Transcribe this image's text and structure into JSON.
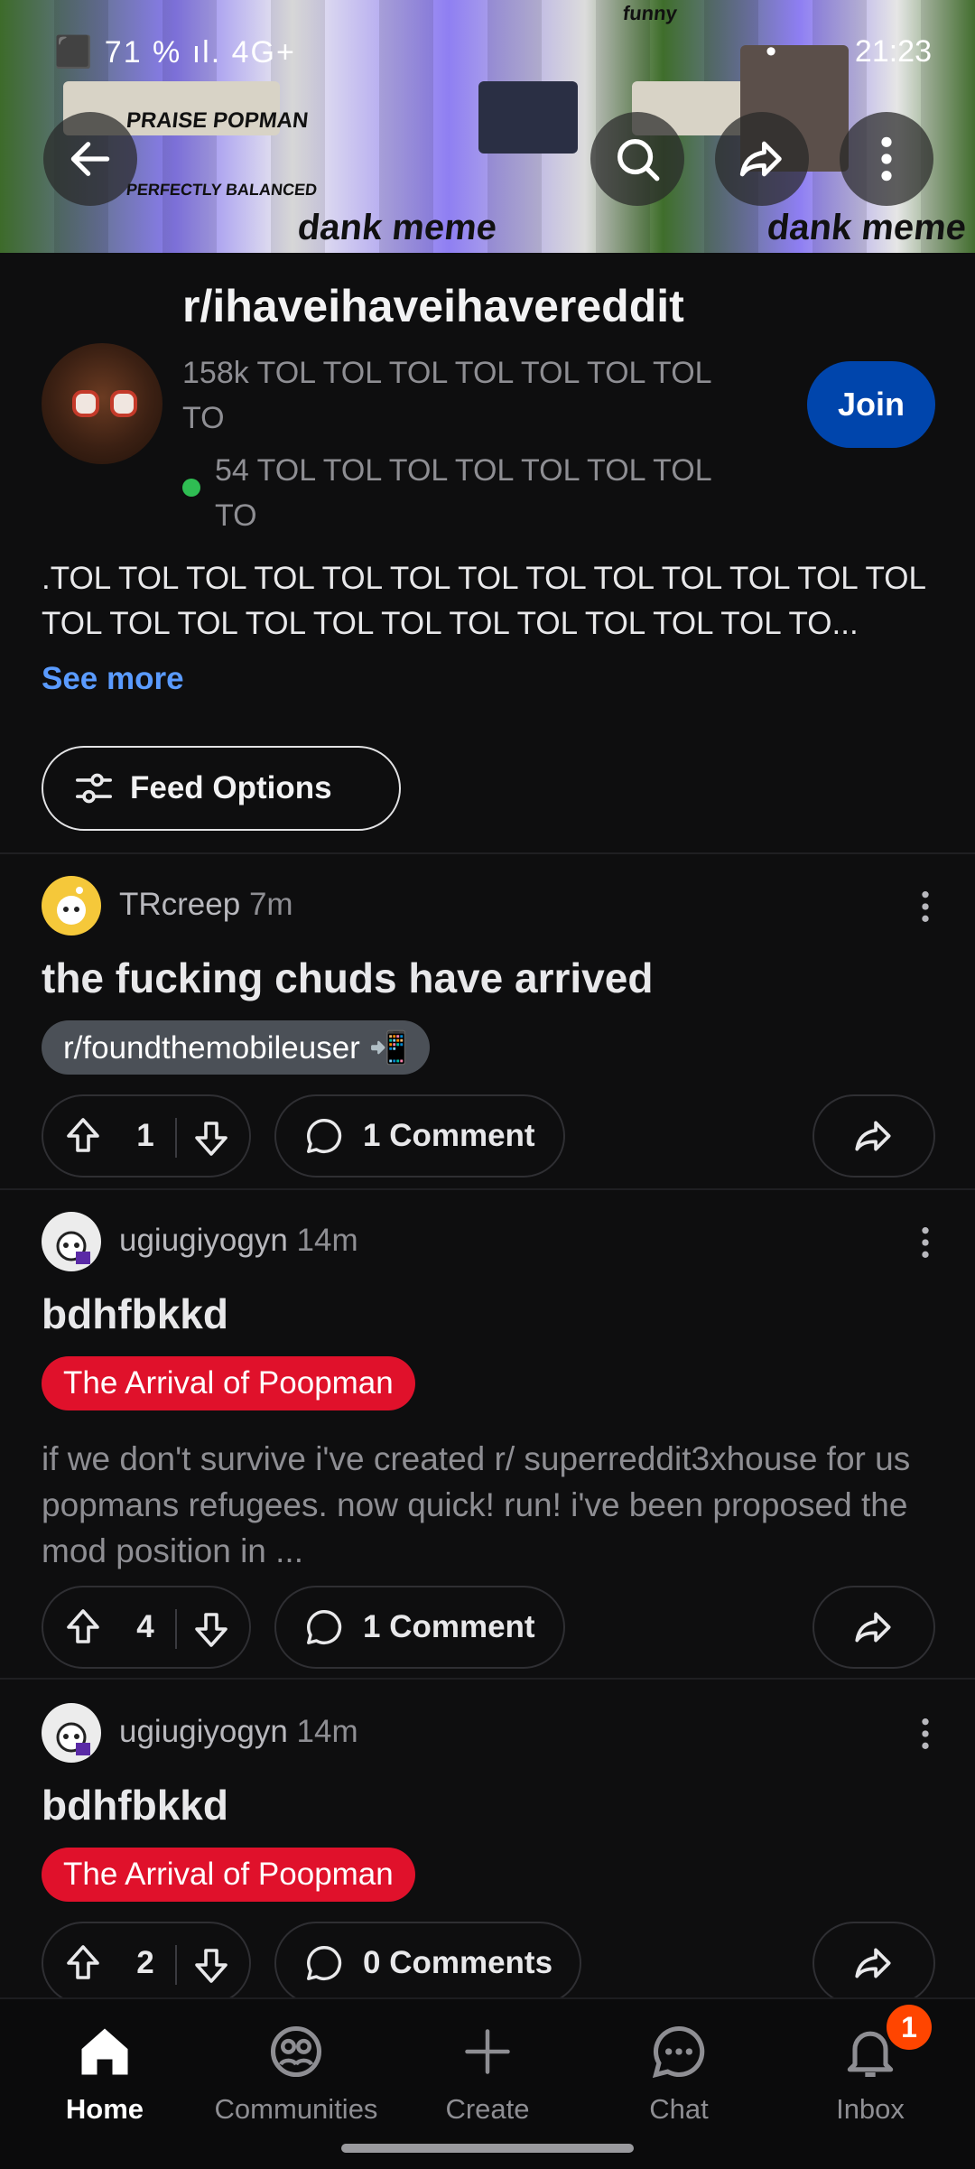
{
  "status_bar": {
    "time": "21:23",
    "left_icons": "⬛ 71 % ıl. 4G+",
    "right_dot": "•"
  },
  "banner": {
    "texts": [
      "funny",
      "PRAISE POPMAN",
      "dank meme",
      "PERFECTLY BALANCED",
      "funny",
      "PRAISE POPMAN",
      "dank meme"
    ]
  },
  "subreddit": {
    "name": "r/ihaveihaveihavereddit",
    "members": "158k TOL TOL TOL TOL TOL TOL TOL TO",
    "online": "54 TOL TOL TOL TOL TOL TOL TOL TO",
    "join_label": "Join",
    "description": ".TOL TOL TOL TOL TOL TOL TOL TOL TOL TOL TOL TOL TOL TOL TOL TOL TOL TOL TOL TOL TOL TOL TOL TOL TO...",
    "see_more": "See more",
    "online_color": "#2fbd53"
  },
  "feed_options": {
    "label": "Feed Options"
  },
  "posts": [
    {
      "author": "TRcreep",
      "time": "7m",
      "title": "the fucking chuds have arrived",
      "flair": "r/foundthemobileuser 📲",
      "votes": "1",
      "comments": "1 Comment"
    },
    {
      "author": "ugiugiyogyn",
      "time": "14m",
      "title": "bdhfbkkd",
      "flair": "The Arrival of Poopman",
      "body": "if we don't survive i've created r/ superreddit3xhouse for us popmans refugees. now quick! run! i've been proposed the mod position in ...",
      "votes": "4",
      "comments": "1 Comment"
    },
    {
      "author": "ugiugiyogyn",
      "time": "14m",
      "title": "bdhfbkkd",
      "flair": "The Arrival of Poopman",
      "votes": "2",
      "comments": "0 Comments"
    }
  ],
  "nav": {
    "home": "Home",
    "communities": "Communities",
    "create": "Create",
    "chat": "Chat",
    "inbox": "Inbox",
    "inbox_badge": "1"
  },
  "colors": {
    "join": "#0045ac",
    "link": "#5a9bff",
    "flair_red": "#e0112b",
    "flair_gray": "#4b5057",
    "badge": "#ff4500"
  }
}
